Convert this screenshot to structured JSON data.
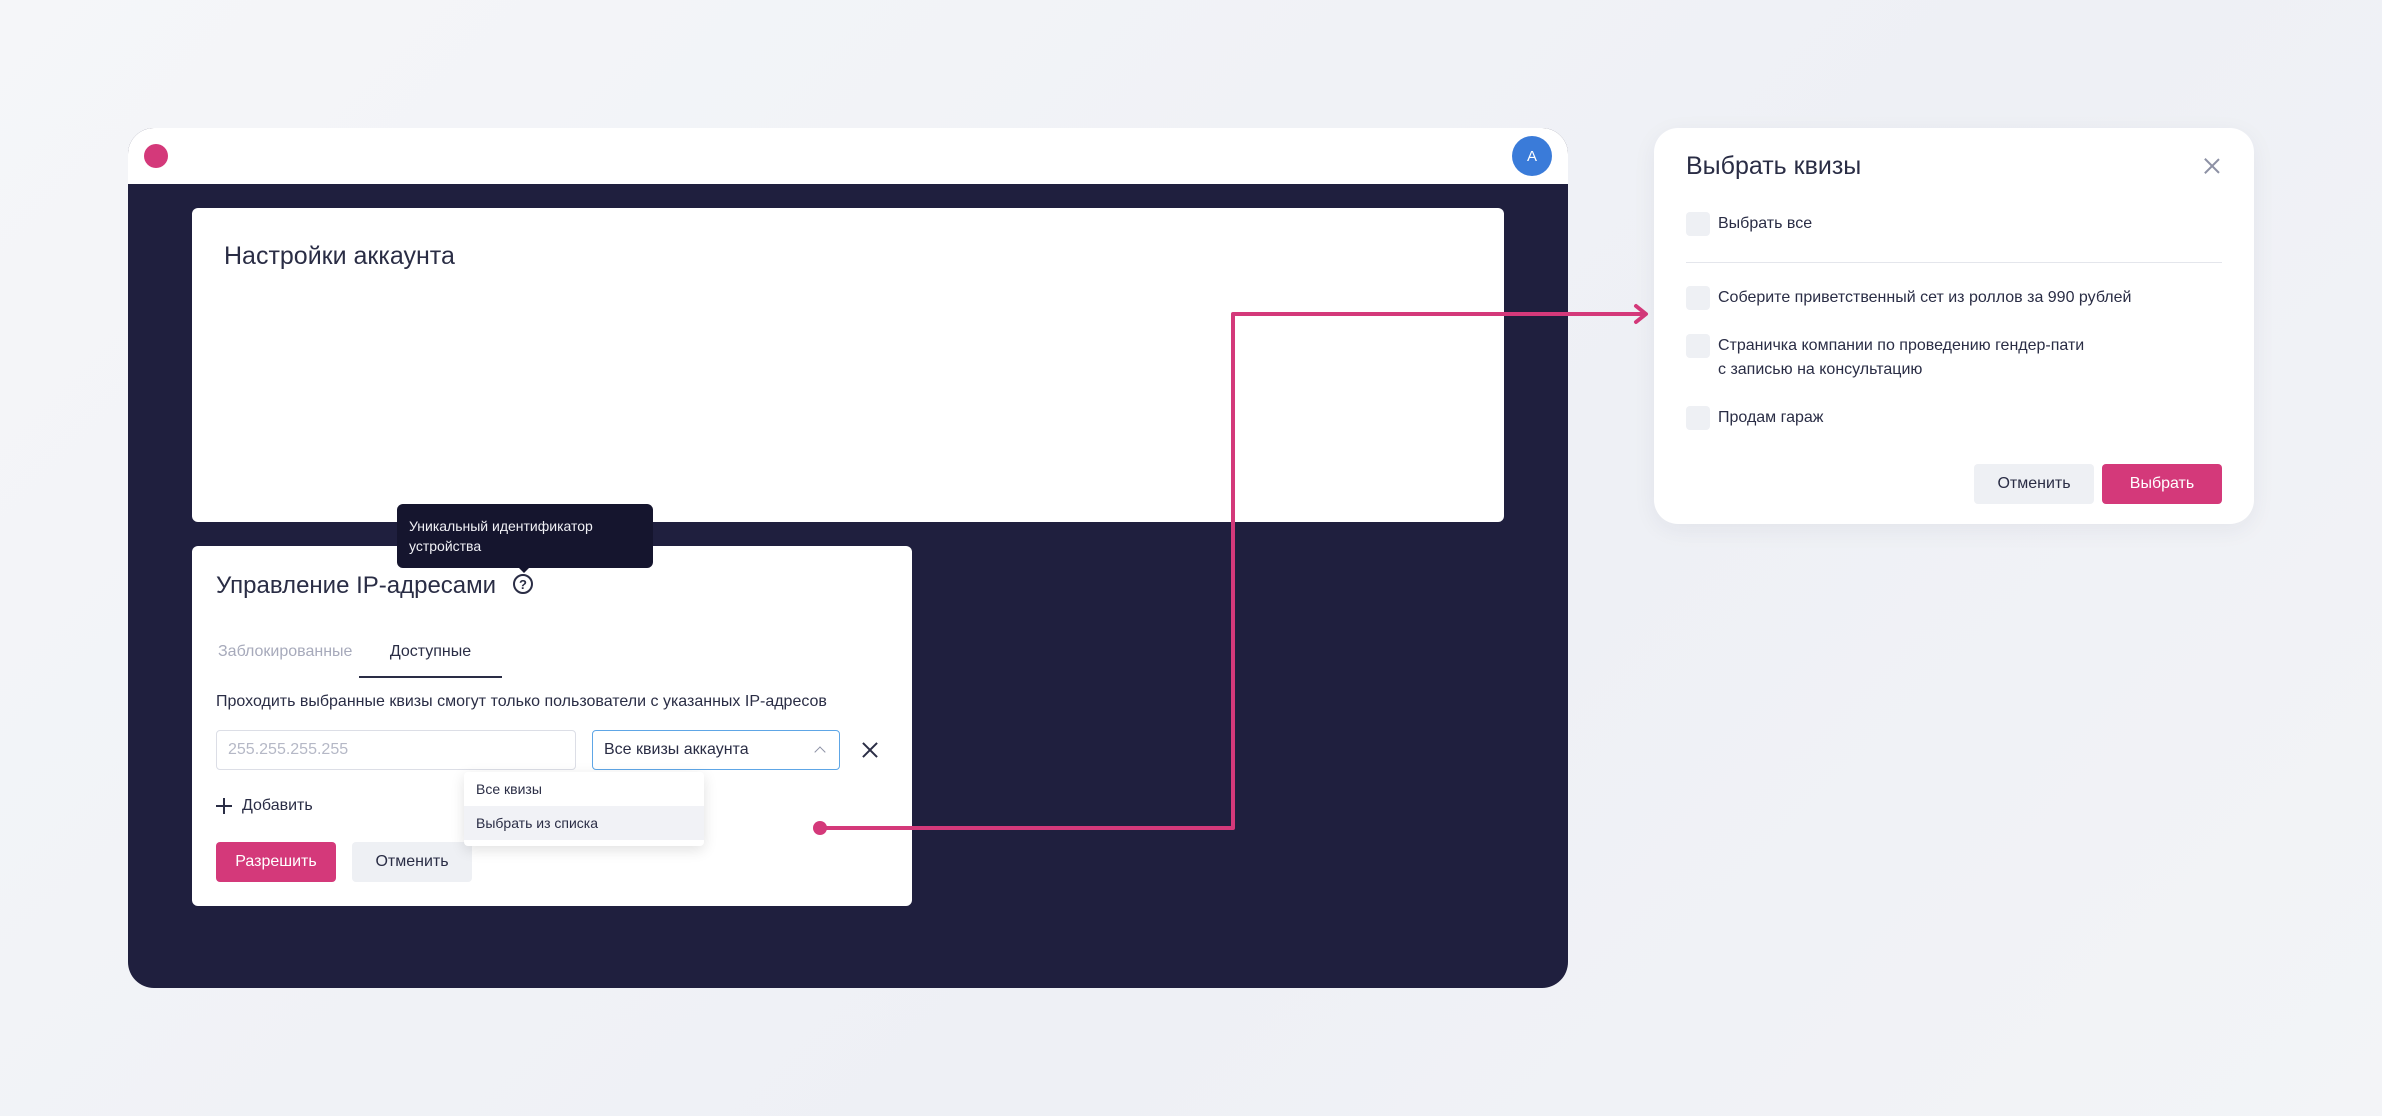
{
  "app": {
    "avatar_initial": "A",
    "brand_color": "#d4397a",
    "avatar_color": "#3a7bd9"
  },
  "settings": {
    "title": "Настройки аккаунта"
  },
  "ip_management": {
    "title": "Управление IP-адресами",
    "help_icon": "question-circle-icon",
    "tooltip": "Уникальный идентификатор устройства",
    "tabs": [
      {
        "label": "Заблокированные",
        "active": false
      },
      {
        "label": "Доступные",
        "active": true
      }
    ],
    "hint": "Проходить выбранные квизы смогут только пользователи с указанных IP-адресов",
    "ip_input": {
      "value": "",
      "placeholder": "255.255.255.255"
    },
    "quiz_select": {
      "selected": "Все квизы аккаунта",
      "options": [
        "Все квизы",
        "Выбрать из списка"
      ],
      "highlighted_option": "Выбрать из списка"
    },
    "add_label": "Добавить",
    "allow_label": "Разрешить",
    "cancel_label": "Отменить"
  },
  "modal": {
    "title": "Выбрать квизы",
    "select_all_label": "Выбрать все",
    "items": [
      {
        "label": "Соберите приветственный сет из роллов за 990 рублей",
        "checked": false
      },
      {
        "label": "Страничка компании по проведению гендер-пати\nс записью на консультацию",
        "checked": false
      },
      {
        "label": "Продам гараж",
        "checked": false
      }
    ],
    "cancel_label": "Отменить",
    "confirm_label": "Выбрать"
  }
}
